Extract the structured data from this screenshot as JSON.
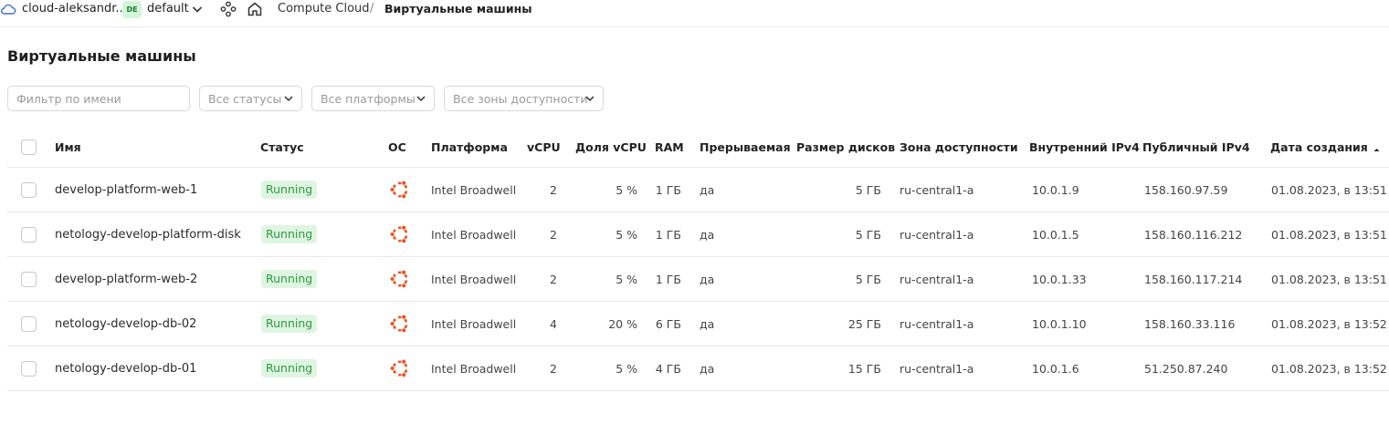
{
  "topbar": {
    "cloud_name": "cloud-aleksandr...",
    "folder_badge": "DE",
    "folder_name": "default",
    "breadcrumb_service": "Compute Cloud",
    "breadcrumb_separator": "/",
    "breadcrumb_current": "Виртуальные машины"
  },
  "page": {
    "title": "Виртуальные машины"
  },
  "filters": {
    "name_placeholder": "Фильтр по имени",
    "status": "Все статусы",
    "platform": "Все платформы",
    "zone": "Все зоны доступности"
  },
  "table": {
    "columns": {
      "name": "Имя",
      "status": "Статус",
      "os": "ОС",
      "platform": "Платформа",
      "vcpu": "vCPU",
      "vcpu_share": "Доля vCPU",
      "ram": "RAM",
      "preemptible": "Прерываемая",
      "disk_size": "Размер дисков",
      "zone": "Зона доступности",
      "internal_ip": "Внутренний IPv4",
      "public_ip": "Публичный IPv4",
      "created": "Дата создания"
    },
    "sort": {
      "column": "created",
      "direction": "ascending",
      "icon": "sort-up-icon"
    },
    "rows": [
      {
        "name": "develop-platform-web-1",
        "status": "Running",
        "os": "ubuntu-icon",
        "platform": "Intel Broadwell",
        "vcpu": "2",
        "vcpu_share": "5 %",
        "ram": "1 ГБ",
        "preemptible": "да",
        "disk_size": "5 ГБ",
        "zone": "ru-central1-a",
        "internal_ip": "10.0.1.9",
        "public_ip": "158.160.97.59",
        "created": "01.08.2023, в 13:51"
      },
      {
        "name": "netology-develop-platform-disk",
        "status": "Running",
        "os": "ubuntu-icon",
        "platform": "Intel Broadwell",
        "vcpu": "2",
        "vcpu_share": "5 %",
        "ram": "1 ГБ",
        "preemptible": "да",
        "disk_size": "5 ГБ",
        "zone": "ru-central1-a",
        "internal_ip": "10.0.1.5",
        "public_ip": "158.160.116.212",
        "created": "01.08.2023, в 13:51"
      },
      {
        "name": "develop-platform-web-2",
        "status": "Running",
        "os": "ubuntu-icon",
        "platform": "Intel Broadwell",
        "vcpu": "2",
        "vcpu_share": "5 %",
        "ram": "1 ГБ",
        "preemptible": "да",
        "disk_size": "5 ГБ",
        "zone": "ru-central1-a",
        "internal_ip": "10.0.1.33",
        "public_ip": "158.160.117.214",
        "created": "01.08.2023, в 13:51"
      },
      {
        "name": "netology-develop-db-02",
        "status": "Running",
        "os": "ubuntu-icon",
        "platform": "Intel Broadwell",
        "vcpu": "4",
        "vcpu_share": "20 %",
        "ram": "6 ГБ",
        "preemptible": "да",
        "disk_size": "25 ГБ",
        "zone": "ru-central1-a",
        "internal_ip": "10.0.1.10",
        "public_ip": "158.160.33.116",
        "created": "01.08.2023, в 13:52"
      },
      {
        "name": "netology-develop-db-01",
        "status": "Running",
        "os": "ubuntu-icon",
        "platform": "Intel Broadwell",
        "vcpu": "2",
        "vcpu_share": "5 %",
        "ram": "4 ГБ",
        "preemptible": "да",
        "disk_size": "15 ГБ",
        "zone": "ru-central1-a",
        "internal_ip": "10.0.1.6",
        "public_ip": "51.250.87.240",
        "created": "01.08.2023, в 13:52"
      }
    ]
  },
  "colors": {
    "status_running_bg": "#dff5e2",
    "status_running_text": "#2a9b3d",
    "ubuntu_orange": "#e95420",
    "cloud_icon": "#3b6fd4"
  }
}
